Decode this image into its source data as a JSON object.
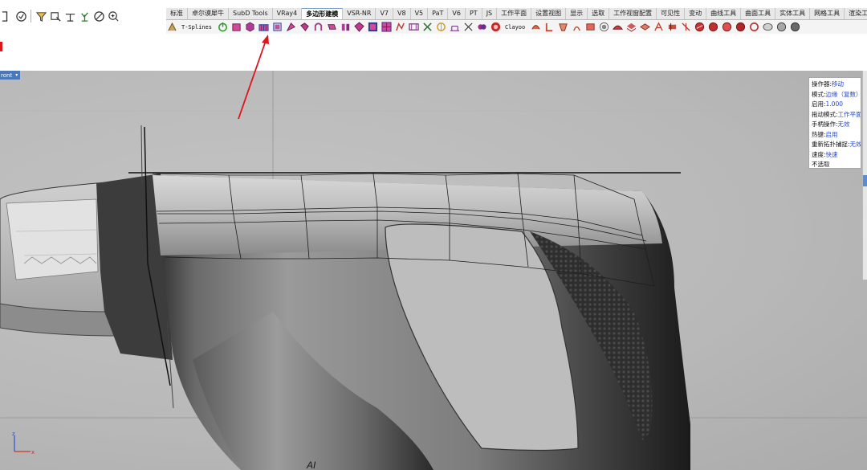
{
  "left_toolbar": {
    "icons": [
      "partial-icon",
      "check-circle-icon",
      "filter-icon",
      "select-lasso-icon",
      "dimension-icon",
      "plant-icon",
      "no-entry-icon",
      "zoom-icon"
    ]
  },
  "tabs": [
    "标准",
    "卓尔谟犀牛",
    "SubD Tools",
    "VRay4",
    "多边形建模",
    "VSR-NR",
    "V7",
    "V8",
    "V5",
    "PaT",
    "V6",
    "PT",
    "JS",
    "工作平面",
    "设置视图",
    "显示",
    "选取",
    "工作视窗配置",
    "可见性",
    "变动",
    "曲线工具",
    "曲面工具",
    "实体工具",
    "网格工具",
    "渲染工"
  ],
  "active_tab": "多边形建模",
  "icon_strip": {
    "tsplines_label": "T-Splines",
    "clayoo_label": "Clayoo"
  },
  "viewport": {
    "name": "ront"
  },
  "properties": {
    "rows": [
      {
        "label": "操作器:",
        "value": "移动"
      },
      {
        "label": "模式:",
        "value": "边缘（复数）"
      },
      {
        "label": "启用:",
        "value": "1.000"
      },
      {
        "label": "拖动模式:",
        "value": "工作平面"
      },
      {
        "label": "手柄操作:",
        "value": "无效"
      },
      {
        "label": "热键:",
        "value": "启用"
      },
      {
        "label": "重新拓扑捕捉:",
        "value": "无效"
      },
      {
        "label": "速度:",
        "value": "快速"
      },
      {
        "label": "不选取",
        "value": ""
      }
    ]
  },
  "colors": {
    "active_tab_accent": "#7a9ec7",
    "viewport_label_bg": "#4a78b8",
    "property_value": "#2a48c8",
    "annotation": "#e0141c"
  },
  "model_text": "AI"
}
